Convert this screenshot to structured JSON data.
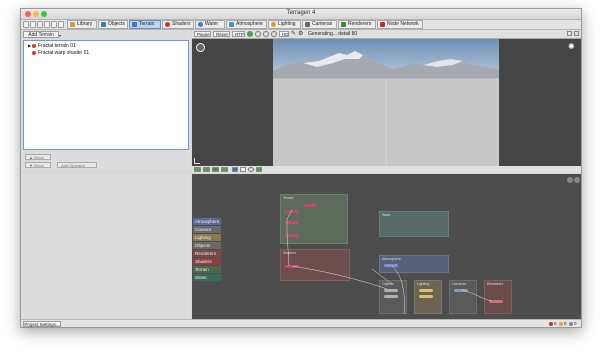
{
  "window": {
    "title": "Terragen 4"
  },
  "tabs": [
    {
      "label": "Library",
      "color": "#c8a040"
    },
    {
      "label": "Objects",
      "color": "#3b7ac8"
    },
    {
      "label": "Terrain",
      "color": "#3b7ac8"
    },
    {
      "label": "Shaders",
      "color": "#d03030"
    },
    {
      "label": "Water",
      "color": "#3b7ac8"
    },
    {
      "label": "Atmosphere",
      "color": "#4a90d8"
    },
    {
      "label": "Lighting",
      "color": "#e0a020"
    },
    {
      "label": "Cameras",
      "color": "#666666"
    },
    {
      "label": "Renderers",
      "color": "#3a8a3a"
    },
    {
      "label": "Node Network",
      "color": "#c03030"
    }
  ],
  "active_tab": "Terrain",
  "left_panel": {
    "add_button": "Add Terrain",
    "tree": [
      {
        "label": "Fractal terrain 01",
        "expandable": true
      },
      {
        "label": "Fractal warp shader 01",
        "expandable": false
      }
    ],
    "move_up": "Move",
    "move_down": "Move",
    "add_operator": "Add Operator"
  },
  "viewport_toolbar": {
    "pause": "Pause",
    "reset": "Reset",
    "rtp": "RTP",
    "hd": "HD",
    "status": "Generating... detail 80"
  },
  "categories": [
    {
      "label": "Atmosphere",
      "color": "#5a6a9a"
    },
    {
      "label": "Camera",
      "color": "#6a6a6a"
    },
    {
      "label": "Lighting",
      "color": "#8a7a4a"
    },
    {
      "label": "Objects",
      "color": "#6a6a6a"
    },
    {
      "label": "Renderers",
      "color": "#7a4a4a"
    },
    {
      "label": "Shaders",
      "color": "#8a4040"
    },
    {
      "label": "Terrain",
      "color": "#4a6a4a"
    },
    {
      "label": "Water",
      "color": "#3a6a5a"
    }
  ],
  "groups": [
    {
      "title": "Terrain",
      "color": "#5d6b5d"
    },
    {
      "title": "Water",
      "color": "#566a66"
    },
    {
      "title": "Shaders",
      "color": "#6d4d4d"
    },
    {
      "title": "Atmosphere",
      "color": "#58607a"
    },
    {
      "title": "Objects",
      "color": "#5a5a5a"
    },
    {
      "title": "Lighting",
      "color": "#6a6450"
    },
    {
      "title": "Cameras",
      "color": "#5a5a5a"
    },
    {
      "title": "Renderers",
      "color": "#6a4c4c"
    }
  ],
  "statusbar": {
    "project_settings": "Project Settings...",
    "errors": "0",
    "warnings": "0",
    "messages": "0"
  }
}
